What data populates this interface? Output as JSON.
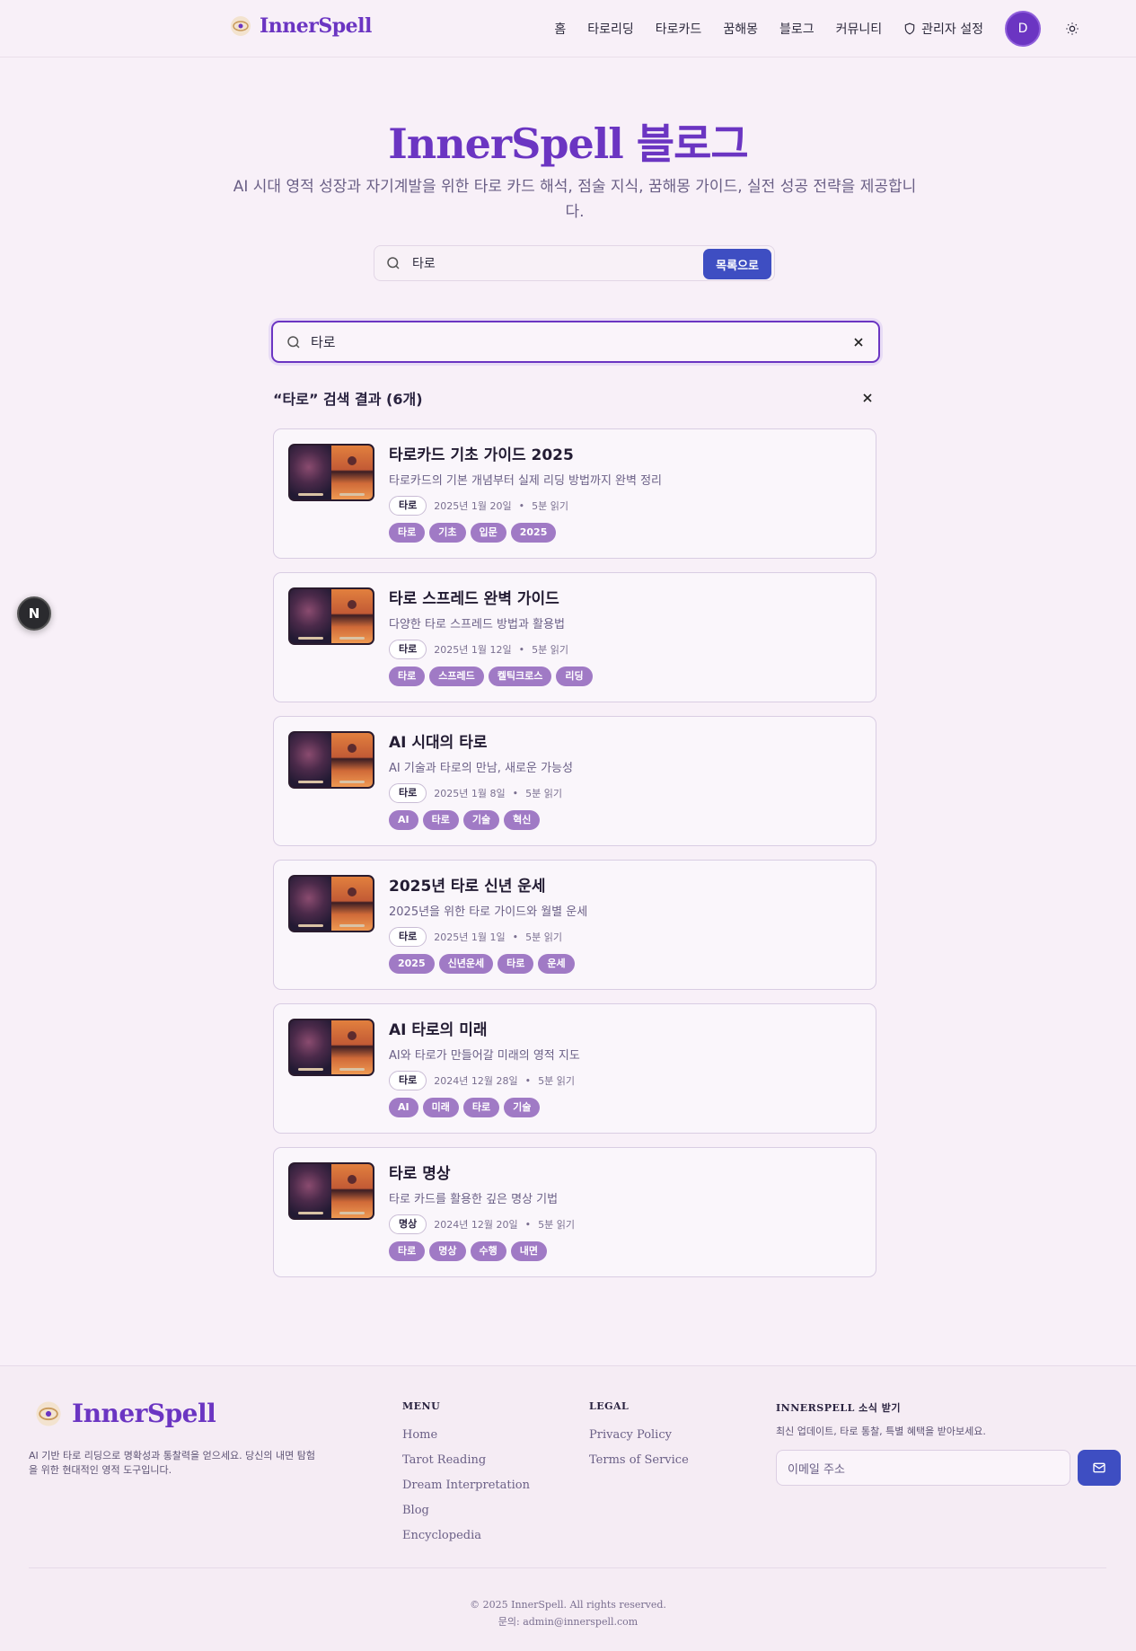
{
  "header": {
    "logo_text": "InnerSpell",
    "nav": [
      {
        "label": "홈"
      },
      {
        "label": "타로리딩"
      },
      {
        "label": "타로카드"
      },
      {
        "label": "꿈해몽"
      },
      {
        "label": "블로그"
      },
      {
        "label": "커뮤니티"
      },
      {
        "label": "관리자 설정"
      }
    ],
    "avatar_initial": "D"
  },
  "hero": {
    "title": "InnerSpell 블로그",
    "subtitle": "AI 시대 영적 성장과 자기계발을 위한 타로 카드 해석, 점술 지식, 꿈해몽 가이드, 실전 성공 전략을 제공합니다."
  },
  "top_search": {
    "value": "타로",
    "button_label": "목록으로"
  },
  "main_search": {
    "value": "타로"
  },
  "results": {
    "heading": "“타로” 검색 결과 (6개)",
    "items": [
      {
        "title": "타로카드 기초 가이드 2025",
        "desc": "타로카드의 기본 개념부터 실제 리딩 방법까지 완벽 정리",
        "category": "타로",
        "date": "2025년 1월 20일",
        "read": "5분 읽기",
        "tags": [
          "타로",
          "기초",
          "입문",
          "2025"
        ]
      },
      {
        "title": "타로 스프레드 완벽 가이드",
        "desc": "다양한 타로 스프레드 방법과 활용법",
        "category": "타로",
        "date": "2025년 1월 12일",
        "read": "5분 읽기",
        "tags": [
          "타로",
          "스프레드",
          "켈틱크로스",
          "리딩"
        ]
      },
      {
        "title": "AI 시대의 타로",
        "desc": "AI 기술과 타로의 만남, 새로운 가능성",
        "category": "타로",
        "date": "2025년 1월 8일",
        "read": "5분 읽기",
        "tags": [
          "AI",
          "타로",
          "기술",
          "혁신"
        ]
      },
      {
        "title": "2025년 타로 신년 운세",
        "desc": "2025년을 위한 타로 가이드와 월별 운세",
        "category": "타로",
        "date": "2025년 1월 1일",
        "read": "5분 읽기",
        "tags": [
          "2025",
          "신년운세",
          "타로",
          "운세"
        ]
      },
      {
        "title": "AI 타로의 미래",
        "desc": "AI와 타로가 만들어갈 미래의 영적 지도",
        "category": "타로",
        "date": "2024년 12월 28일",
        "read": "5분 읽기",
        "tags": [
          "AI",
          "미래",
          "타로",
          "기술"
        ]
      },
      {
        "title": "타로 명상",
        "desc": "타로 카드를 활용한 깊은 명상 기법",
        "category": "명상",
        "date": "2024년 12월 20일",
        "read": "5분 읽기",
        "tags": [
          "타로",
          "명상",
          "수행",
          "내면"
        ]
      }
    ]
  },
  "fab_label": "N",
  "footer": {
    "logo_text": "InnerSpell",
    "desc": "AI 기반 타로 리딩으로 명확성과 통찰력을 얻으세요. 당신의 내면 탐험을 위한 현대적인 영적 도구입니다.",
    "menu_heading": "MENU",
    "menu": [
      "Home",
      "Tarot Reading",
      "Dream Interpretation",
      "Blog",
      "Encyclopedia"
    ],
    "legal_heading": "LEGAL",
    "legal": [
      "Privacy Policy",
      "Terms of Service"
    ],
    "news_heading": "INNERSPELL 소식 받기",
    "news_desc": "최신 업데이트, 타로 통찰, 특별 혜택을 받아보세요.",
    "email_placeholder": "이메일 주소",
    "copyright": "© 2025 InnerSpell. All rights reserved.",
    "contact": "문의: admin@innerspell.com"
  },
  "colors": {
    "brand": "#6b35c2",
    "button": "#3e4ec2",
    "tag": "#a07ac5",
    "background": "#f8f0f8"
  }
}
